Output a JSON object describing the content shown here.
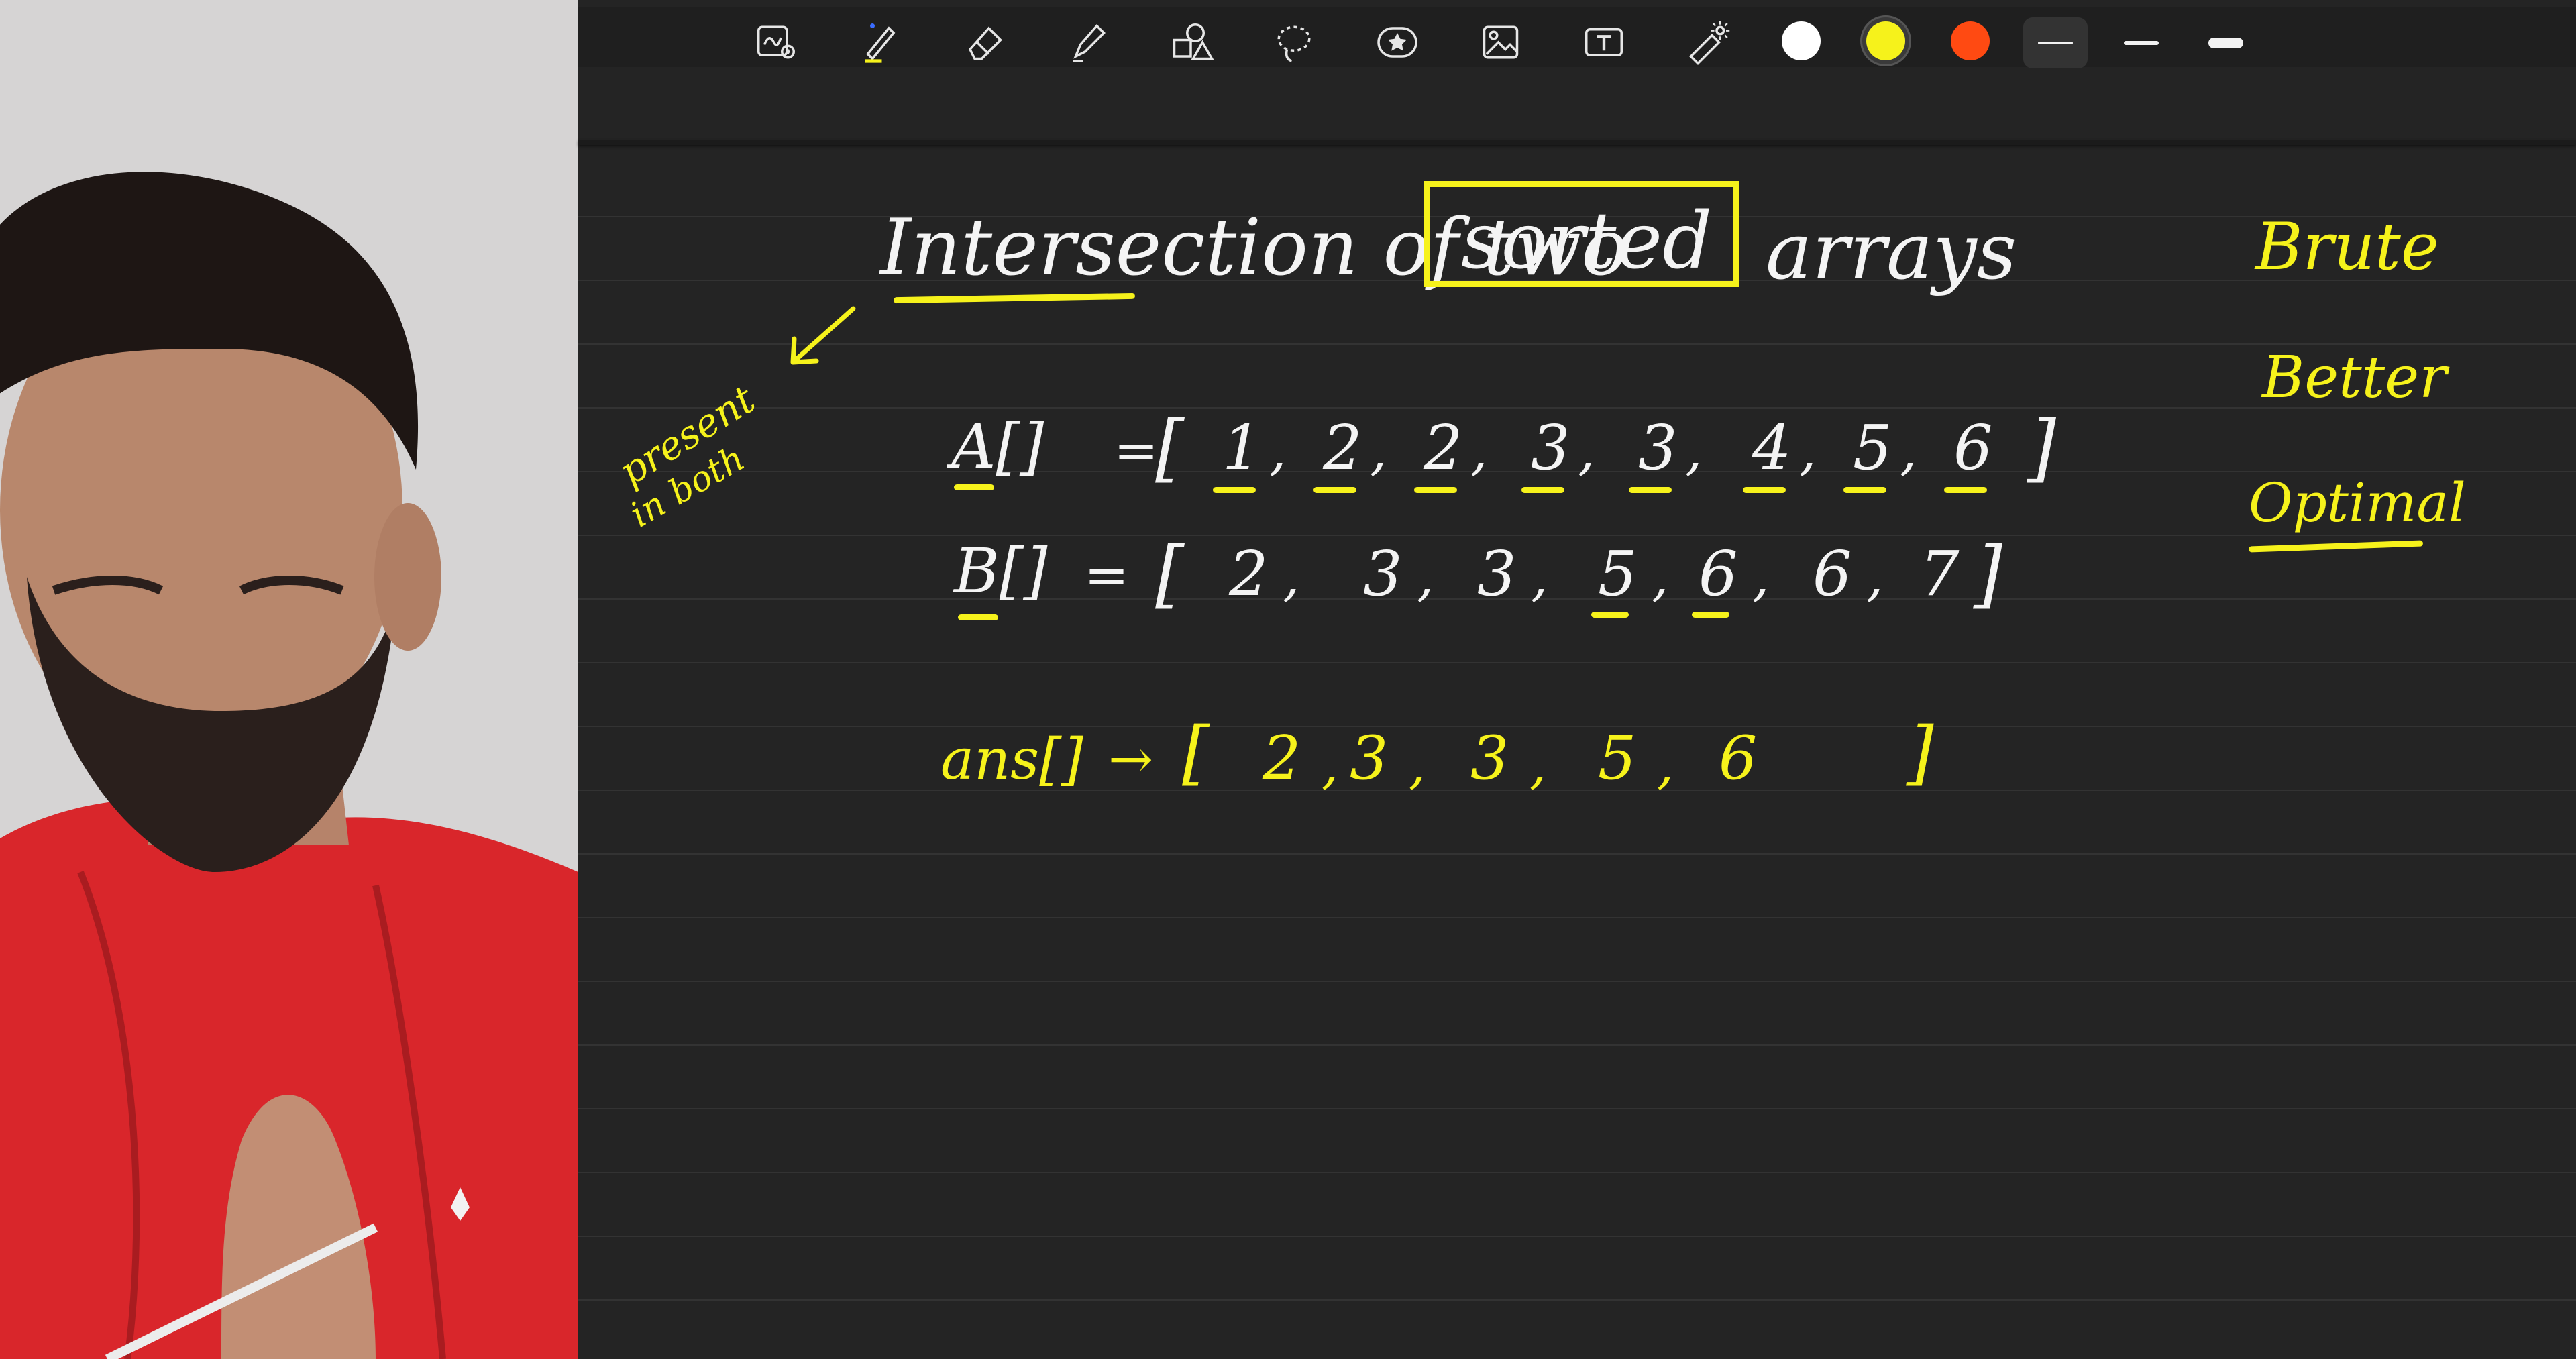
{
  "toolbar": {
    "tools": [
      {
        "name": "lasso-zoom-tool-icon"
      },
      {
        "name": "pen-tool-icon"
      },
      {
        "name": "eraser-tool-icon"
      },
      {
        "name": "highlighter-tool-icon"
      },
      {
        "name": "shapes-tool-icon"
      },
      {
        "name": "lasso-select-tool-icon"
      },
      {
        "name": "sticker-tool-icon"
      },
      {
        "name": "image-tool-icon"
      },
      {
        "name": "text-tool-icon"
      },
      {
        "name": "laser-pointer-tool-icon"
      }
    ],
    "colors": [
      "#ffffff",
      "#f6f21b",
      "#ff4a12"
    ],
    "active_color": "#f6f21b"
  },
  "board": {
    "title_part1": "Intersection of two",
    "title_boxed": "sorted",
    "title_part3": "arrays",
    "side_note_line1": "present",
    "side_note_line2": "in both",
    "approaches": {
      "brute": "Brute",
      "better": "Better",
      "optimal": "Optimal"
    },
    "array_a_label": "A[]",
    "array_a_eq": "=",
    "array_a_values": [
      "1",
      "2",
      "2",
      "3",
      "3",
      "4",
      "5",
      "6"
    ],
    "array_b_label": "B[]",
    "array_b_eq": "=",
    "array_b_values": [
      "2",
      "3",
      "3",
      "5",
      "6",
      "6",
      "7"
    ],
    "ans_label": "ans[]",
    "ans_arrow": "→",
    "ans_values": [
      "2",
      "3",
      "3",
      "5",
      "6"
    ],
    "open_bracket": "[",
    "close_bracket": "]"
  }
}
